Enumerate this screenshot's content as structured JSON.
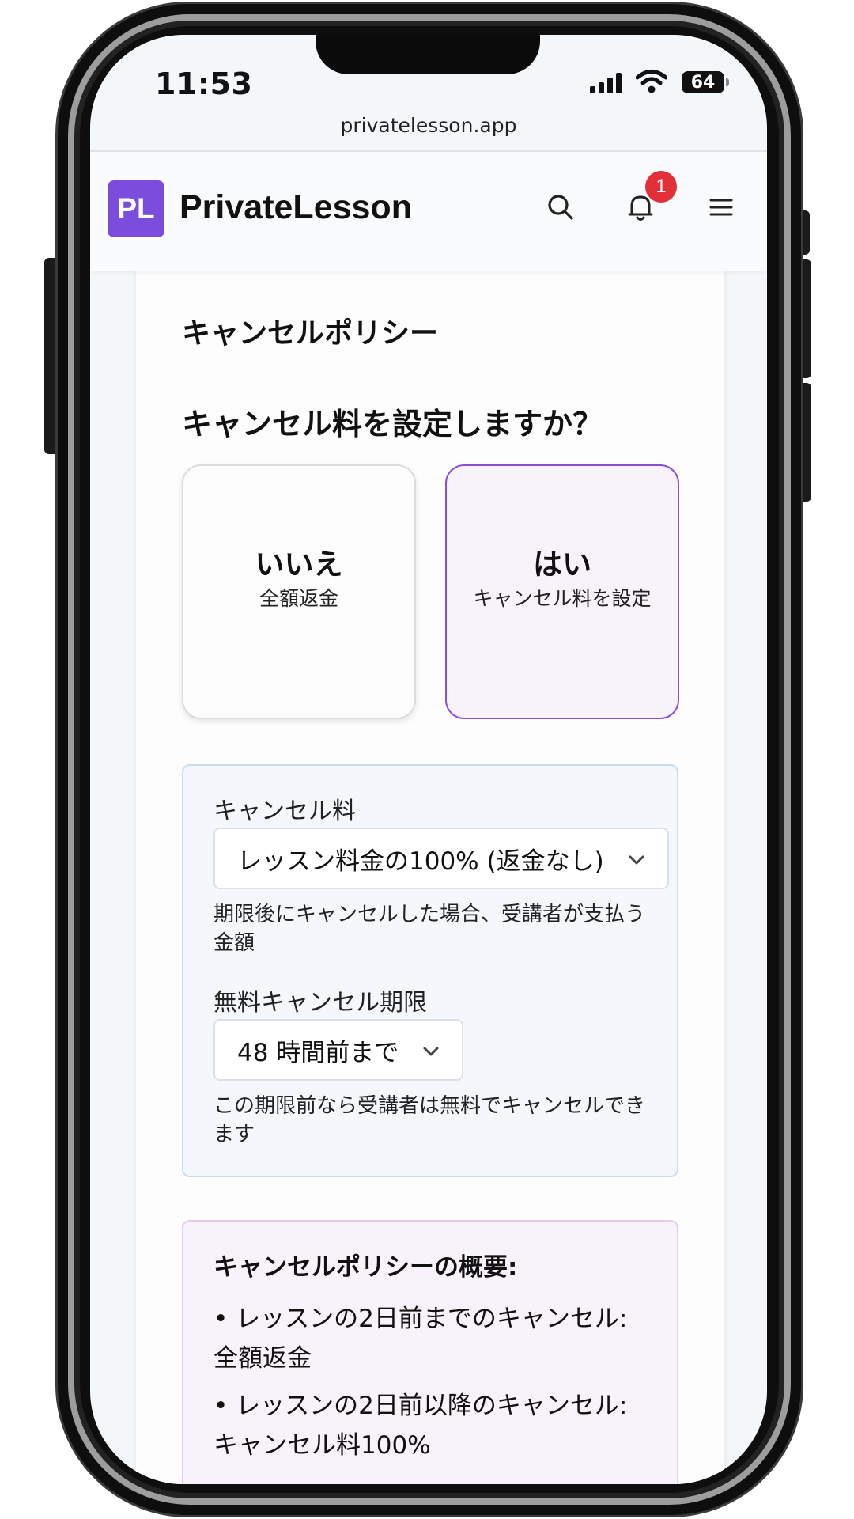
{
  "status": {
    "time": "11:53",
    "battery": "64"
  },
  "browser": {
    "url": "privatelesson.app"
  },
  "header": {
    "logo": "PL",
    "brand": "PrivateLesson",
    "notification_count": "1"
  },
  "icons": [
    "search-icon",
    "bell-icon",
    "menu-icon",
    "chevron-down-icon",
    "signal-icon",
    "wifi-icon",
    "battery-icon"
  ],
  "section": {
    "title": "キャンセルポリシー",
    "question": "キャンセル料を設定しますか？"
  },
  "options": [
    {
      "title": "いいえ",
      "subtitle": "全額返金",
      "selected": false
    },
    {
      "title": "はい",
      "subtitle": "キャンセル料を設定",
      "selected": true
    }
  ],
  "fee": {
    "label": "キャンセル料",
    "value": "レッスン料金の100% (返金なし)",
    "help": "期限後にキャンセルした場合、受講者が支払う金額"
  },
  "deadline": {
    "label": "無料キャンセル期限",
    "value": "48 時間前まで",
    "help": "この期限前なら受講者は無料でキャンセルできます"
  },
  "summary": {
    "title": "キャンセルポリシーの概要:",
    "items": [
      "• レッスンの2日前までのキャンセル: 全額返金",
      "• レッスンの2日前以降のキャンセル: キャンセル料100%"
    ]
  },
  "colors": {
    "accent": "#7c4ddd",
    "selected_border": "#8a4fd6",
    "badge": "#e32f37",
    "panel_bg": "#f4f8fc",
    "summary_bg": "#f8f3fb"
  }
}
